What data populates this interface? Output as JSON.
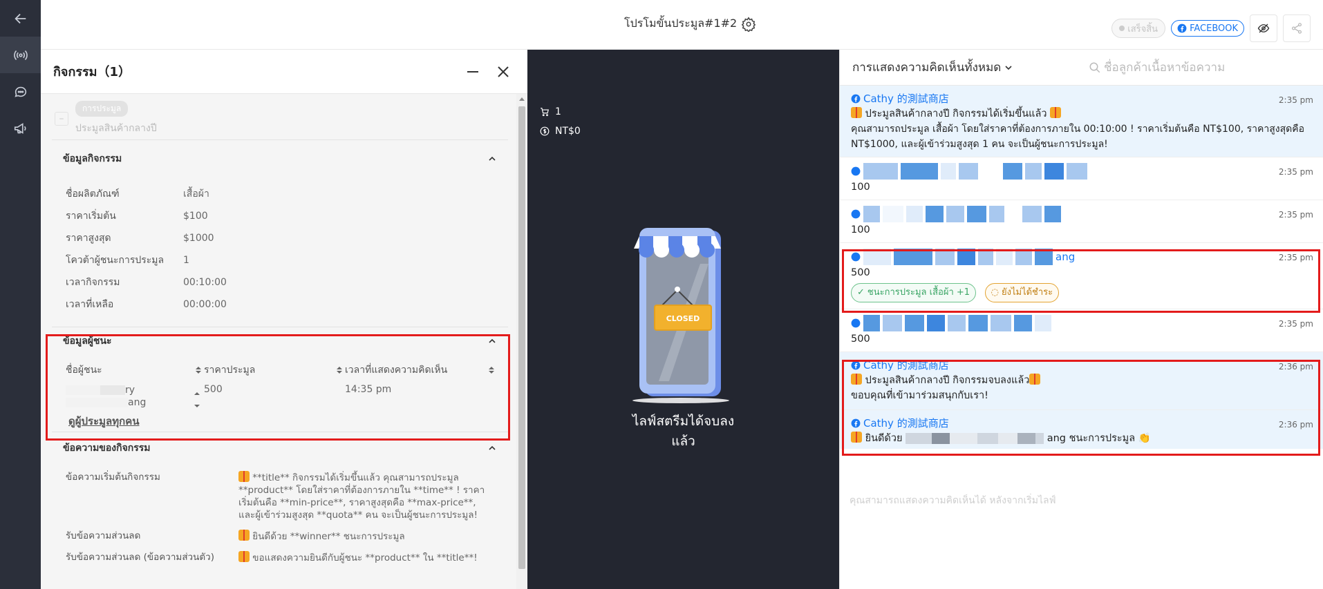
{
  "rail": {
    "items": [
      "back",
      "live",
      "chat",
      "announce"
    ]
  },
  "topbar": {
    "title": "โปรโมขั้นประมูล#1#2",
    "status": "เสร็จสิ้น",
    "platform": "FACEBOOK"
  },
  "panel": {
    "title": "กิจกรรม（1）",
    "auction_tag": "การประมูล",
    "auction_name": "ประมูลสินค้ากลางปี",
    "info": {
      "title": "ข้อมูลกิจกรรม",
      "rows": [
        {
          "k": "ชื่อผลิตภัณฑ์",
          "v": "เสื้อผ้า"
        },
        {
          "k": "ราคาเริ่มต้น",
          "v": "$100"
        },
        {
          "k": "ราคาสูงสุด",
          "v": "$1000"
        },
        {
          "k": "โควต้าผู้ชนะการประมูล",
          "v": "1"
        },
        {
          "k": "เวลากิจกรรม",
          "v": "00:10:00"
        },
        {
          "k": "เวลาที่เหลือ",
          "v": "00:00:00"
        }
      ]
    },
    "winners": {
      "title": "ข้อมูลผู้ชนะ",
      "col_name": "ชื่อผู้ชนะ",
      "col_price": "ราคาประมูล",
      "col_time": "เวลาที่แสดงความคิดเห็น",
      "row_name_a": "ry",
      "row_name_b": "ang",
      "row_price": "500",
      "row_time": "14:35 pm",
      "see_all": "ดูผู้ประมูลทุกคน"
    },
    "messages": {
      "title": "ข้อความของกิจกรรม",
      "rows": [
        {
          "k": "ข้อความเริ่มต้นกิจกรรม",
          "v": "**title** กิจกรรมได้เริ่มขึ้นแล้ว คุณสามารถประมูล **product** โดยใส่ราคาที่ต้องการภายใน **time** ! ราคาเริ่มต้นคือ **min-price**, ราคาสูงสุดคือ **max-price**, และผู้เข้าร่วมสูงสุด **quota** คน จะเป็นผู้ชนะการประมูล!"
        },
        {
          "k": "รับข้อความส่วนลด",
          "v": "ยินดีด้วย **winner** ชนะการประมูล"
        },
        {
          "k": "รับข้อความส่วนลด (ข้อความส่วนตัว)",
          "v": "ขอแสดงความยินดีกับผู้ชนะ **product** ใน **title**!"
        }
      ]
    }
  },
  "video": {
    "cart_count": "1",
    "amount": "NT$0",
    "closed_sign": "CLOSED",
    "ended_line1": "ไลฟ์สตรีมได้จบลง",
    "ended_line2": "แล้ว"
  },
  "comments": {
    "title": "การแสดงความคิดเห็นทั้งหมด",
    "search_placeholder": "ชื่อลูกค้าเนื้อหาข้อความ",
    "shop_name": "Cathy 的測試商店",
    "c1_line1": "ประมูลสินค้ากลางปี กิจกรรมได้เริ่มขึ้นแล้ว",
    "c1_line2": "คุณสามารถประมูล เสื้อผ้า โดยใส่ราคาที่ต้องการภายใน 00:10:00 ! ราคาเริ่มต้นคือ NT$100, ราคาสูงสุดคือ NT$1000, และผู้เข้าร่วมสูงสุด 1 คน จะเป็นผู้ชนะการประมูล!",
    "time_a": "2:35 pm",
    "time_b": "2:36 pm",
    "v100": "100",
    "v500": "500",
    "user4_suffix": "ang",
    "chip_win": "ชนะการประมูล เสื้อผ้า +1",
    "chip_unpaid": "ยังไม่ได้ชำระ",
    "c6_line1": "ประมูลสินค้ากลางปี กิจกรรมจบลงแล้ว",
    "c6_line2": "ขอบคุณที่เข้ามาร่วมสนุกกับเรา!",
    "c7_prefix": "ยินดีด้วย",
    "c7_suffix": "ang ชนะการประมูล",
    "footer": "คุณสามารถแสดงความคิดเห็นได้ หลังจากเริ่มไลฟ์"
  }
}
